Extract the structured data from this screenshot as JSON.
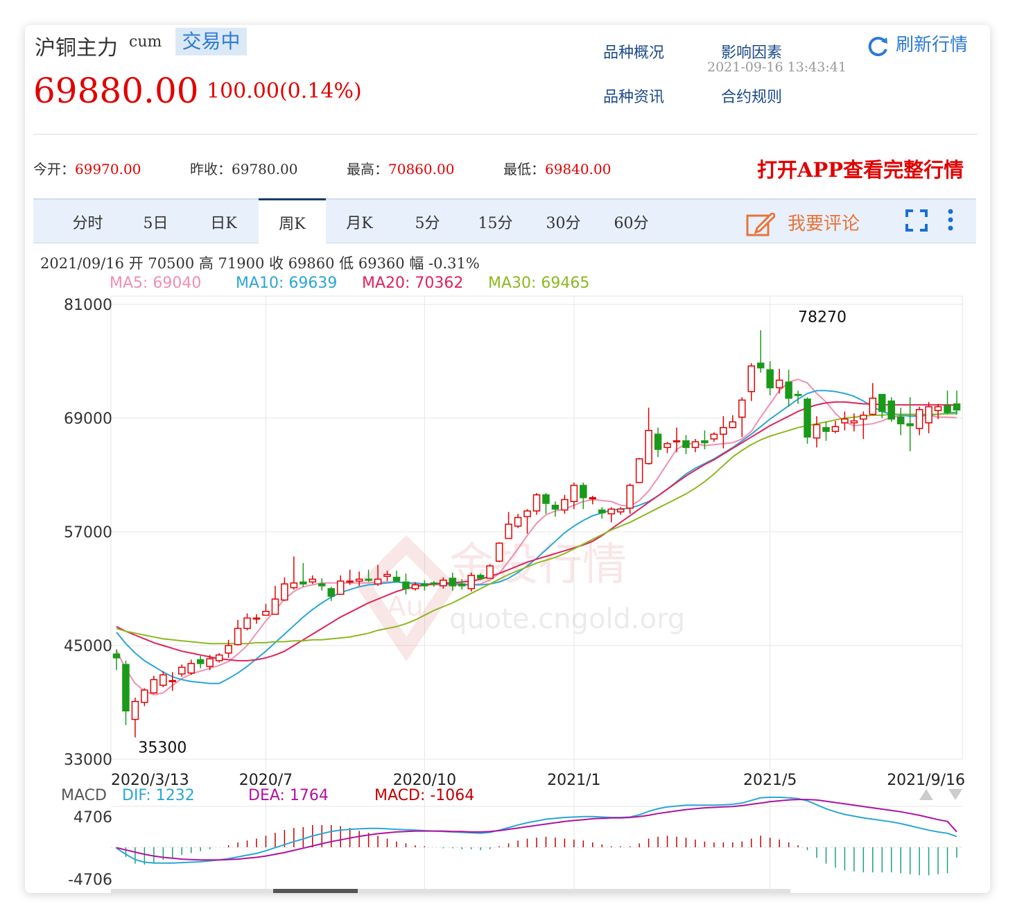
{
  "header": {
    "title": "沪铜主力",
    "code": "cum",
    "status": "交易中",
    "price": "69880.00",
    "change": "100.00(0.14%)",
    "links": [
      "品种概况",
      "影响因素",
      "品种资讯",
      "合约规则"
    ],
    "timestamp": "2021-09-16 13:43:41",
    "refresh_label": "刷新行情"
  },
  "quote": {
    "open_label": "今开：",
    "open": "69970.00",
    "prev_label": "昨收：",
    "prev": "69780.00",
    "high_label": "最高：",
    "high": "70860.00",
    "low_label": "最低：",
    "low": "69840.00",
    "cta": "打开APP查看完整行情"
  },
  "tabs": [
    "分时",
    "5日",
    "日K",
    "周K",
    "月K",
    "5分",
    "15分",
    "30分",
    "60分"
  ],
  "active_tab": "周K",
  "comment_label": "我要评论",
  "icons": {
    "refresh": "refresh-icon",
    "comment": "edit-icon",
    "fullscreen": "fullscreen-icon",
    "more": "more-vert-icon"
  },
  "ohlc_line": "2021/09/16  开 70500  高 71900  收 69860  低 69360  幅 -0.31%",
  "ma": [
    {
      "label": "MA5: 69040",
      "color": "#f08fb0"
    },
    {
      "label": "MA10: 69639",
      "color": "#2aa6d6"
    },
    {
      "label": "MA20: 70362",
      "color": "#e0225a"
    },
    {
      "label": "MA30: 69465",
      "color": "#8cb820"
    }
  ],
  "watermark": {
    "brand": "金投行情",
    "url": "quote.cngold.org",
    "logo": "Au"
  },
  "chart_data": {
    "type": "candlestick",
    "y_ticks": [
      "81000",
      "69000",
      "57000",
      "45000",
      "33000"
    ],
    "ylim": [
      33000,
      81000
    ],
    "x_labels": [
      {
        "label": "2020/3/13",
        "index": 0
      },
      {
        "label": "2020/7",
        "index": 16
      },
      {
        "label": "2020/10",
        "index": 33
      },
      {
        "label": "2021/1",
        "index": 49
      },
      {
        "label": "2021/5",
        "index": 70
      },
      {
        "label": "2021/9/16",
        "index": 89
      }
    ],
    "annotations": [
      {
        "text": "78270",
        "index": 75,
        "value": 78270
      },
      {
        "text": "35300",
        "index": 3,
        "value": 35300
      }
    ],
    "candles": [
      [
        44100,
        43700,
        44600,
        42400
      ],
      [
        43000,
        38100,
        43400,
        36600
      ],
      [
        37200,
        39100,
        39500,
        35300
      ],
      [
        39000,
        40300,
        40500,
        38600
      ],
      [
        40000,
        41400,
        41800,
        39900
      ],
      [
        40800,
        41900,
        42300,
        40600
      ],
      [
        41300,
        41300,
        42200,
        40200
      ],
      [
        42000,
        42700,
        43000,
        41700
      ],
      [
        42100,
        43100,
        43500,
        41900
      ],
      [
        43500,
        43100,
        43900,
        42600
      ],
      [
        42800,
        43600,
        44000,
        42400
      ],
      [
        43400,
        44000,
        44200,
        43200
      ],
      [
        44200,
        45000,
        45600,
        43700
      ],
      [
        45100,
        46800,
        47700,
        45000
      ],
      [
        46800,
        47900,
        48400,
        46600
      ],
      [
        47900,
        47900,
        48300,
        47300
      ],
      [
        48200,
        48600,
        49400,
        48300
      ],
      [
        48300,
        49900,
        51300,
        48400
      ],
      [
        49800,
        51500,
        52200,
        49700
      ],
      [
        51100,
        51600,
        54400,
        50900
      ],
      [
        51700,
        51500,
        53700,
        51200
      ],
      [
        51700,
        52000,
        52400,
        51500
      ],
      [
        51500,
        51300,
        52100,
        50800
      ],
      [
        51000,
        50200,
        51200,
        49700
      ],
      [
        50400,
        51800,
        52400,
        50400
      ],
      [
        51700,
        51800,
        53000,
        51400
      ],
      [
        51800,
        52000,
        52800,
        51300
      ],
      [
        52000,
        51900,
        53000,
        51700
      ],
      [
        51500,
        52000,
        53500,
        51300
      ],
      [
        52300,
        52500,
        52900,
        51800
      ],
      [
        52200,
        51800,
        52900,
        51700
      ],
      [
        51700,
        51000,
        52600,
        50400
      ],
      [
        51000,
        51400,
        51700,
        50800
      ],
      [
        51500,
        51300,
        51900,
        50800
      ],
      [
        51600,
        51500,
        51800,
        51200
      ],
      [
        51300,
        51900,
        52200,
        51000
      ],
      [
        52100,
        51300,
        52700,
        50800
      ],
      [
        51500,
        51300,
        52000,
        50900
      ],
      [
        51000,
        52400,
        52700,
        50700
      ],
      [
        52400,
        52100,
        52600,
        51900
      ],
      [
        52100,
        53400,
        53600,
        52200
      ],
      [
        53900,
        55800,
        55900,
        53800
      ],
      [
        56300,
        57800,
        59100,
        56300
      ],
      [
        57600,
        58500,
        58900,
        57400
      ],
      [
        58600,
        59200,
        59400,
        56800
      ],
      [
        59200,
        60900,
        61100,
        58800
      ],
      [
        60900,
        60000,
        61100,
        58900
      ],
      [
        59800,
        59400,
        60200,
        58600
      ],
      [
        59300,
        60400,
        60900,
        58900
      ],
      [
        60200,
        61900,
        62200,
        59400
      ],
      [
        61900,
        60600,
        62200,
        59400
      ],
      [
        60600,
        60600,
        60800,
        59900
      ],
      [
        59300,
        59000,
        59600,
        58400
      ],
      [
        58900,
        59400,
        59600,
        58000
      ],
      [
        59100,
        59400,
        59600,
        58800
      ],
      [
        59500,
        61900,
        62100,
        58900
      ],
      [
        62200,
        64700,
        64800,
        62200
      ],
      [
        64200,
        67700,
        70100,
        64100
      ],
      [
        67300,
        65700,
        68000,
        64900
      ],
      [
        65900,
        66300,
        66500,
        65300
      ],
      [
        66500,
        66600,
        68000,
        65400
      ],
      [
        66600,
        65900,
        67200,
        65200
      ],
      [
        65900,
        66500,
        66800,
        65400
      ],
      [
        66600,
        66400,
        67700,
        65700
      ],
      [
        66800,
        67300,
        67500,
        66500
      ],
      [
        67300,
        68000,
        69200,
        65800
      ],
      [
        68000,
        68600,
        69300,
        67900
      ],
      [
        69100,
        70900,
        71200,
        67000
      ],
      [
        71800,
        74500,
        74800,
        70800
      ],
      [
        74800,
        74300,
        78270,
        73800
      ],
      [
        74100,
        72200,
        75000,
        71400
      ],
      [
        72200,
        73000,
        74200,
        71600
      ],
      [
        72800,
        71100,
        74100,
        70200
      ],
      [
        71500,
        71400,
        71900,
        70500
      ],
      [
        71000,
        67000,
        71200,
        66300
      ],
      [
        66900,
        68300,
        69200,
        65900
      ],
      [
        68000,
        67600,
        68600,
        66600
      ],
      [
        67600,
        68100,
        68700,
        67400
      ],
      [
        68500,
        68900,
        69700,
        67700
      ],
      [
        68500,
        68700,
        69500,
        67600
      ],
      [
        68900,
        69300,
        69700,
        66800
      ],
      [
        69400,
        71100,
        72700,
        69300
      ],
      [
        71500,
        69700,
        71400,
        69000
      ],
      [
        70800,
        68900,
        71200,
        68600
      ],
      [
        69100,
        68400,
        70100,
        67200
      ],
      [
        68400,
        68200,
        71200,
        65500
      ],
      [
        67900,
        69900,
        70200,
        67200
      ],
      [
        68500,
        70200,
        70700,
        67400
      ],
      [
        69800,
        70200,
        70500,
        68900
      ],
      [
        70300,
        69600,
        71900,
        69400
      ],
      [
        70500,
        69860,
        71900,
        69360
      ]
    ],
    "series": [
      {
        "name": "MA5",
        "color": "#f08fb0",
        "values": [
          44500,
          42500,
          41000,
          40200,
          39800,
          40000,
          40800,
          41500,
          42000,
          42300,
          42600,
          42900,
          43300,
          44100,
          45000,
          46300,
          47600,
          48700,
          49900,
          50700,
          51200,
          51400,
          51600,
          51600,
          51600,
          51600,
          51600,
          51600,
          51700,
          51700,
          51700,
          51600,
          51500,
          51400,
          51400,
          51400,
          51400,
          51400,
          51400,
          51500,
          51900,
          52600,
          53900,
          55200,
          56600,
          57900,
          58800,
          59200,
          59400,
          59800,
          60200,
          60400,
          60300,
          60200,
          59800,
          59700,
          60300,
          61300,
          62700,
          64200,
          65700,
          66300,
          66300,
          66100,
          66200,
          66300,
          66400,
          66800,
          67600,
          69100,
          70500,
          71900,
          72800,
          73100,
          72700,
          71600,
          70700,
          69500,
          68600,
          68200,
          68300,
          68400,
          68700,
          69100,
          69200,
          69400,
          69200,
          69300,
          69100,
          69100,
          69040
        ]
      },
      {
        "name": "MA10",
        "color": "#2aa6d6",
        "values": [
          46400,
          45200,
          44200,
          43400,
          42800,
          42200,
          41700,
          41400,
          41200,
          41100,
          41000,
          41000,
          41500,
          42100,
          42800,
          43600,
          44400,
          45300,
          46200,
          47100,
          48000,
          48800,
          49500,
          50100,
          50600,
          50900,
          51200,
          51400,
          51500,
          51600,
          51700,
          51600,
          51600,
          51500,
          51500,
          51500,
          51500,
          51500,
          51400,
          51400,
          51500,
          51700,
          52100,
          52700,
          53400,
          54200,
          55100,
          56000,
          56900,
          57600,
          58200,
          58700,
          59000,
          59300,
          59400,
          59500,
          59800,
          60200,
          60800,
          61500,
          62300,
          63100,
          63700,
          64200,
          64700,
          65300,
          65900,
          66600,
          67300,
          68100,
          68900,
          69600,
          70300,
          71000,
          71600,
          71900,
          71900,
          71800,
          71600,
          71300,
          70800,
          70200,
          69700,
          69400,
          69300,
          69200,
          69200,
          69300,
          69400,
          69500,
          69639
        ]
      },
      {
        "name": "MA20",
        "color": "#e0225a",
        "values": [
          47000,
          46500,
          46100,
          45700,
          45300,
          45000,
          44700,
          44400,
          44200,
          44000,
          43800,
          43600,
          43500,
          43400,
          43400,
          43500,
          43700,
          44000,
          44400,
          45000,
          45600,
          46200,
          46800,
          47400,
          48000,
          48500,
          49000,
          49500,
          49900,
          50300,
          50700,
          51000,
          51200,
          51400,
          51500,
          51600,
          51600,
          51700,
          51800,
          52000,
          52300,
          52600,
          53000,
          53400,
          53800,
          54100,
          54400,
          54700,
          55000,
          55300,
          55600,
          56000,
          56600,
          57300,
          58000,
          58700,
          59400,
          60100,
          60800,
          61500,
          62200,
          62900,
          63500,
          64100,
          64600,
          65200,
          65800,
          66400,
          67000,
          67600,
          68200,
          68700,
          69200,
          69700,
          70100,
          70400,
          70600,
          70700,
          70700,
          70600,
          70500,
          70500,
          70400,
          70400,
          70400,
          70400,
          70400,
          70400,
          70400,
          70400,
          70362
        ]
      },
      {
        "name": "MA30",
        "color": "#8cb820",
        "values": [
          46800,
          46500,
          46300,
          46100,
          45900,
          45700,
          45600,
          45500,
          45400,
          45300,
          45200,
          45200,
          45200,
          45200,
          45200,
          45300,
          45300,
          45400,
          45400,
          45500,
          45500,
          45600,
          45600,
          45700,
          45800,
          45900,
          46100,
          46300,
          46600,
          46800,
          47000,
          47300,
          47700,
          48200,
          48700,
          49100,
          49500,
          50000,
          50500,
          51000,
          51500,
          52000,
          52500,
          52900,
          53300,
          53700,
          54000,
          54300,
          54700,
          55200,
          55700,
          56200,
          56700,
          57200,
          57600,
          58000,
          58500,
          59000,
          59500,
          60000,
          60500,
          61000,
          61600,
          62300,
          63100,
          64000,
          64900,
          65600,
          66200,
          66700,
          67100,
          67400,
          67700,
          68000,
          68200,
          68400,
          68600,
          68800,
          69000,
          69100,
          69200,
          69300,
          69300,
          69400,
          69400,
          69400,
          69400,
          69400,
          69400,
          69450,
          69465
        ]
      }
    ],
    "macd": {
      "label": "MACD",
      "dif_label": "DIF: 1232",
      "dif_color": "#2aa6d6",
      "dea_label": "DEA: 1764",
      "dea_color": "#b0129e",
      "macd_label": "MACD: -1064",
      "macd_color": "#c00000",
      "y_ticks": [
        "4706",
        "-4706"
      ],
      "ylim": [
        -4706,
        4706
      ],
      "dif": [
        -100,
        -800,
        -1400,
        -1700,
        -1800,
        -1800,
        -1800,
        -1750,
        -1700,
        -1650,
        -1550,
        -1450,
        -1300,
        -1100,
        -900,
        -700,
        -400,
        -50,
        300,
        650,
        950,
        1300,
        1550,
        1800,
        1950,
        2050,
        2100,
        2150,
        2150,
        2100,
        2050,
        2000,
        1950,
        1900,
        1850,
        1800,
        1750,
        1700,
        1650,
        1600,
        1700,
        1950,
        2250,
        2550,
        2800,
        3000,
        3200,
        3300,
        3400,
        3450,
        3500,
        3500,
        3450,
        3400,
        3400,
        3450,
        3700,
        4100,
        4400,
        4600,
        4700,
        4800,
        4800,
        4800,
        4800,
        4850,
        4900,
        5050,
        5350,
        5650,
        5700,
        5700,
        5650,
        5550,
        5300,
        4850,
        4400,
        4050,
        3750,
        3550,
        3350,
        3200,
        3050,
        2900,
        2700,
        2450,
        2200,
        1950,
        1750,
        1600,
        1232
      ],
      "dea": [
        -50,
        -300,
        -550,
        -800,
        -1000,
        -1150,
        -1250,
        -1350,
        -1400,
        -1450,
        -1450,
        -1450,
        -1400,
        -1350,
        -1250,
        -1150,
        -1000,
        -800,
        -600,
        -350,
        -100,
        150,
        400,
        650,
        850,
        1050,
        1250,
        1400,
        1550,
        1650,
        1750,
        1800,
        1850,
        1850,
        1850,
        1850,
        1800,
        1800,
        1750,
        1750,
        1800,
        1900,
        2050,
        2200,
        2350,
        2500,
        2650,
        2800,
        2950,
        3050,
        3150,
        3250,
        3300,
        3350,
        3350,
        3400,
        3500,
        3650,
        3850,
        4000,
        4150,
        4300,
        4400,
        4500,
        4550,
        4600,
        4650,
        4750,
        4900,
        5050,
        5200,
        5300,
        5400,
        5450,
        5450,
        5400,
        5250,
        5100,
        4950,
        4800,
        4650,
        4500,
        4350,
        4200,
        4050,
        3850,
        3650,
        3400,
        3150,
        2950,
        1764
      ]
    }
  }
}
